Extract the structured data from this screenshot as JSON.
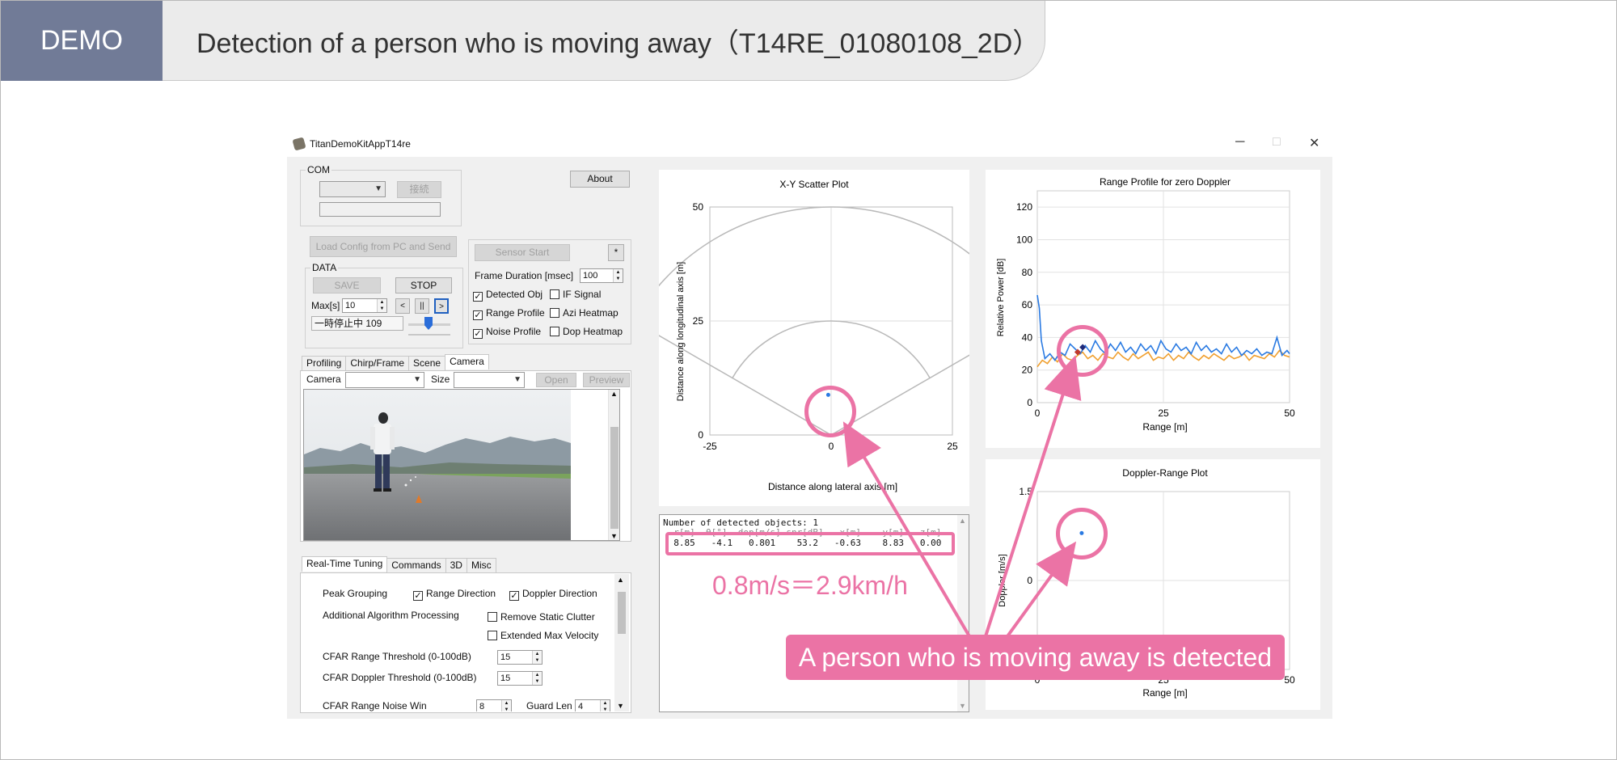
{
  "header": {
    "tag": "DEMO",
    "title": "Detection of a person who is moving away（T14RE_01080108_2D）"
  },
  "window": {
    "title": "TitanDemoKitAppT14re",
    "minimize": "─",
    "maximize": "□",
    "close": "✕"
  },
  "left": {
    "com_label": "COM",
    "connect_label": "接続",
    "about_label": "About",
    "load_config_label": "Load Config from PC and Send",
    "sensor_start_label": "Sensor Start",
    "star_label": "*",
    "frame_duration_label": "Frame Duration [msec]",
    "frame_duration_value": "100",
    "data_label": "DATA",
    "save_label": "SAVE",
    "stop_label": "STOP",
    "max_label": "Max[s]",
    "max_value": "10",
    "prev_label": "<",
    "pause_label": "||",
    "next_label": ">",
    "status_text": "一時停止中 109",
    "checkboxes": [
      {
        "label": "Detected Obj",
        "checked": "✓"
      },
      {
        "label": "IF Signal",
        "checked": ""
      },
      {
        "label": "Range Profile",
        "checked": "✓"
      },
      {
        "label": "Azi Heatmap",
        "checked": ""
      },
      {
        "label": "Noise Profile",
        "checked": "✓"
      },
      {
        "label": "Dop Heatmap",
        "checked": ""
      }
    ],
    "tabs": [
      "Profiling",
      "Chirp/Frame",
      "Scene",
      "Camera"
    ],
    "camera_label": "Camera",
    "size_label": "Size",
    "open_label": "Open",
    "preview_label": "Preview",
    "tuning_tabs": [
      "Real-Time Tuning",
      "Commands",
      "3D",
      "Misc"
    ],
    "peak_grouping_label": "Peak Grouping",
    "range_direction_label": "Range Direction",
    "doppler_direction_label": "Doppler Direction",
    "additional_label": "Additional Algorithm Processing",
    "remove_static_label": "Remove Static Clutter",
    "extended_max_label": "Extended Max Velocity",
    "cfar_range_label": "CFAR Range Threshold (0-100dB)",
    "cfar_range_value": "15",
    "cfar_doppler_label": "CFAR Doppler Threshold (0-100dB)",
    "cfar_doppler_value": "15",
    "cfar_noise_label": "CFAR Range Noise Win",
    "cfar_noise_value": "8",
    "guard_len_label": "Guard Len",
    "guard_len_value": "4"
  },
  "detected": {
    "header_line": "Number of detected objects: 1",
    "values_line": "  8.85   -4.1   0.801    53.2   -0.63    8.83   0.00"
  },
  "annotations": {
    "speed_text": "0.8m/s＝2.9km/h",
    "callout_text": "A person who is moving away is detected"
  },
  "chart_data": [
    {
      "type": "scatter",
      "title": "X-Y Scatter Plot",
      "xlabel": "Distance along lateral axis [m]",
      "ylabel": "Distance along longitudinal axis [m]",
      "xlim": [
        -25,
        25
      ],
      "ylim": [
        0,
        50
      ],
      "xticks": [
        "-25",
        "0",
        "25"
      ],
      "yticks": [
        "0",
        "25",
        "50"
      ],
      "points": [
        {
          "x": -0.6,
          "y": 8.8
        }
      ],
      "color": "#2a7ae2"
    },
    {
      "type": "line",
      "title": "Range Profile for zero Doppler",
      "xlabel": "Range [m]",
      "ylabel": "Relative Power [dB]",
      "xlim": [
        0,
        50
      ],
      "ylim": [
        0,
        130
      ],
      "xticks": [
        "0",
        "25",
        "50"
      ],
      "yticks": [
        "0",
        "20",
        "40",
        "60",
        "80",
        "100",
        "120"
      ],
      "series": [
        {
          "color": "#2a7ae2",
          "x": [
            0,
            0.4,
            0.8,
            1.5,
            2.5,
            3.5,
            4.5,
            5.5,
            6.5,
            7.5,
            8.5,
            9.5,
            10.5,
            11.5,
            12.5,
            13.5,
            14.5,
            15.5,
            16.5,
            17.5,
            18.5,
            19.5,
            20.5,
            21.5,
            22.5,
            23.5,
            24.5,
            25.5,
            26.5,
            27.5,
            28.5,
            29.5,
            30.5,
            31.5,
            32.5,
            33.5,
            34.5,
            35.5,
            36.5,
            37.5,
            38.5,
            39.5,
            40.5,
            41.5,
            42.5,
            43.5,
            44.5,
            45.5,
            46.5,
            47.5,
            48.5,
            49.5,
            50
          ],
          "values": [
            66,
            58,
            38,
            27,
            30,
            26,
            31,
            29,
            36,
            33,
            30,
            35,
            31,
            38,
            33,
            30,
            36,
            32,
            37,
            31,
            34,
            30,
            36,
            32,
            35,
            30,
            38,
            33,
            31,
            36,
            32,
            34,
            30,
            37,
            32,
            35,
            31,
            33,
            30,
            36,
            31,
            34,
            29,
            32,
            30,
            33,
            29,
            31,
            30,
            40,
            29,
            32,
            30
          ]
        },
        {
          "color": "#f0a030",
          "x": [
            0,
            1,
            2,
            3,
            4,
            5,
            6,
            7,
            8,
            9,
            10,
            11,
            12,
            13,
            14,
            15,
            16,
            17,
            18,
            19,
            20,
            21,
            22,
            23,
            24,
            25,
            26,
            27,
            28,
            29,
            30,
            31,
            32,
            33,
            34,
            35,
            36,
            37,
            38,
            39,
            40,
            41,
            42,
            43,
            44,
            45,
            46,
            47,
            48,
            49,
            50
          ],
          "values": [
            22,
            26,
            24,
            28,
            25,
            30,
            27,
            26,
            29,
            31,
            27,
            29,
            26,
            30,
            28,
            27,
            31,
            28,
            26,
            30,
            27,
            29,
            31,
            26,
            28,
            27,
            30,
            26,
            29,
            27,
            31,
            28,
            26,
            29,
            27,
            30,
            28,
            26,
            29,
            27,
            28,
            30,
            26,
            29,
            28,
            27,
            30,
            28,
            32,
            29,
            28
          ]
        }
      ],
      "markers": [
        {
          "x": 9,
          "y": 34,
          "color": "#1f2a7a"
        },
        {
          "x": 8,
          "y": 31,
          "color": "#c0392b"
        }
      ]
    },
    {
      "type": "scatter",
      "title": "Doppler-Range Plot",
      "xlabel": "Range [m]",
      "ylabel": "Doppler [m/s]",
      "xlim": [
        0,
        50
      ],
      "ylim": [
        -1.5,
        1.5
      ],
      "xticks": [
        "0",
        "25",
        "50"
      ],
      "yticks": [
        "0",
        "1.5"
      ],
      "points": [
        {
          "x": 8.8,
          "y": 0.8
        }
      ],
      "color": "#2a7ae2"
    }
  ]
}
